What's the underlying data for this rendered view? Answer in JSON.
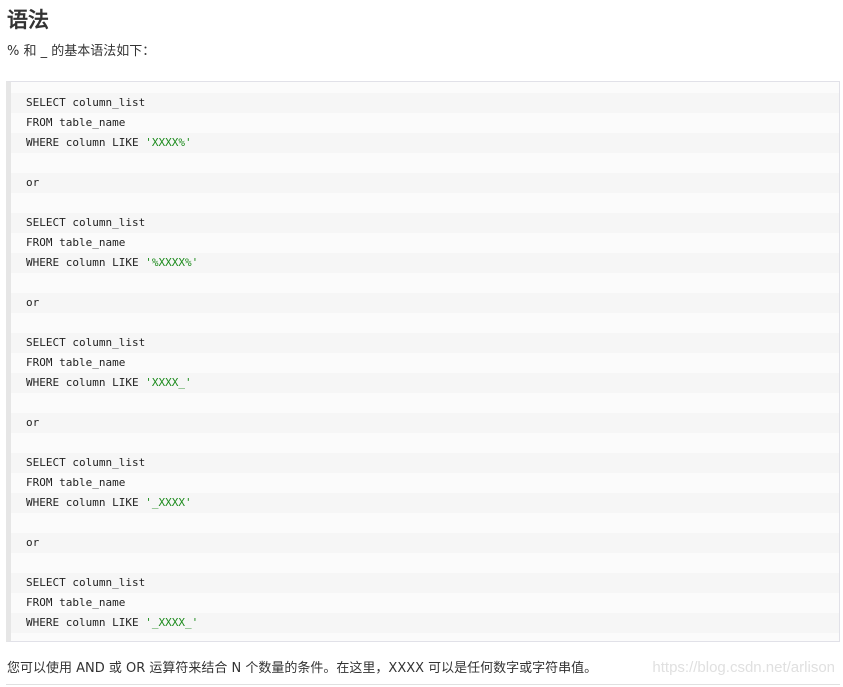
{
  "heading": "语法",
  "intro": "% 和 _ 的基本语法如下：",
  "code_lines": [
    {
      "code": "SELECT column_list",
      "str": ""
    },
    {
      "code": "FROM table_name",
      "str": ""
    },
    {
      "code": "WHERE column LIKE ",
      "str": "'XXXX%'"
    },
    {
      "code": "",
      "str": ""
    },
    {
      "code": "or",
      "str": ""
    },
    {
      "code": "",
      "str": ""
    },
    {
      "code": "SELECT column_list",
      "str": ""
    },
    {
      "code": "FROM table_name",
      "str": ""
    },
    {
      "code": "WHERE column LIKE ",
      "str": "'%XXXX%'"
    },
    {
      "code": "",
      "str": ""
    },
    {
      "code": "or",
      "str": ""
    },
    {
      "code": "",
      "str": ""
    },
    {
      "code": "SELECT column_list",
      "str": ""
    },
    {
      "code": "FROM table_name",
      "str": ""
    },
    {
      "code": "WHERE column LIKE ",
      "str": "'XXXX_'"
    },
    {
      "code": "",
      "str": ""
    },
    {
      "code": "or",
      "str": ""
    },
    {
      "code": "",
      "str": ""
    },
    {
      "code": "SELECT column_list",
      "str": ""
    },
    {
      "code": "FROM table_name",
      "str": ""
    },
    {
      "code": "WHERE column LIKE ",
      "str": "'_XXXX'"
    },
    {
      "code": "",
      "str": ""
    },
    {
      "code": "or",
      "str": ""
    },
    {
      "code": "",
      "str": ""
    },
    {
      "code": "SELECT column_list",
      "str": ""
    },
    {
      "code": "FROM table_name",
      "str": ""
    },
    {
      "code": "WHERE column LIKE ",
      "str": "'_XXXX_'"
    }
  ],
  "footer": "您可以使用 AND 或 OR 运算符来结合 N 个数量的条件。在这里，XXXX 可以是任何数字或字符串值。",
  "watermark": "https://blog.csdn.net/arlison",
  "colors": {
    "string_literal": "#1a8a1a",
    "code_background": "#fbfbfb",
    "code_stripe": "#f6f6f6"
  }
}
